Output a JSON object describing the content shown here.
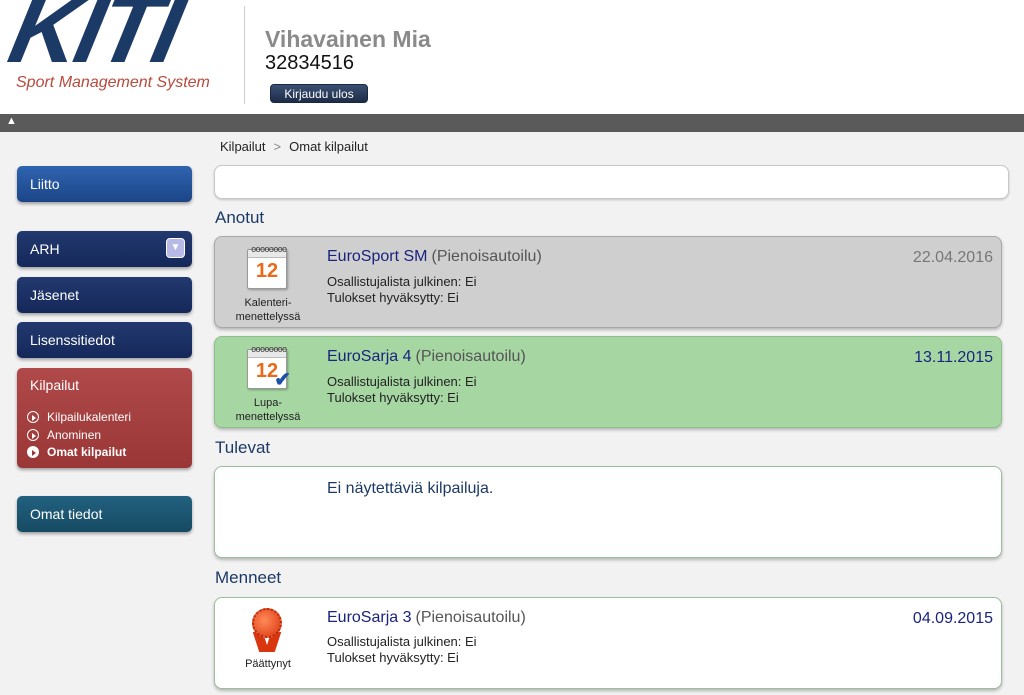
{
  "header": {
    "logo_text": "KITI",
    "logo_subtitle": "Sport Management System",
    "user_name": "Vihavainen Mia",
    "user_id": "32834516",
    "logout_label": "Kirjaudu ulos",
    "toggle_glyph": "▲"
  },
  "breadcrumb": {
    "items": [
      "Kilpailut",
      "Omat kilpailut"
    ],
    "separator": ">"
  },
  "sidebar": {
    "liitto": "Liitto",
    "arh": "ARH",
    "arh_toggle_glyph": "▼",
    "jasenet": "Jäsenet",
    "lisenssitiedot": "Lisenssitiedot",
    "kilpailut": {
      "title": "Kilpailut",
      "items": [
        "Kilpailukalenteri",
        "Anominen",
        "Omat kilpailut"
      ],
      "active_item": "Omat kilpailut"
    },
    "omat_tiedot": "Omat tiedot"
  },
  "sections": {
    "anotut": "Anotut",
    "tulevat": "Tulevat",
    "menneet": "Menneet"
  },
  "cards": {
    "card1": {
      "title": "EuroSport SM",
      "category": "(Pienoisautoilu)",
      "date": "22.04.2016",
      "line1": "Osallistujalista julkinen: Ei",
      "line2": "Tulokset hyväksytty: Ei",
      "icon_label": "Kalenteri-\nmenettelyssä",
      "icon_num": "12"
    },
    "card2": {
      "title": "EuroSarja 4",
      "category": "(Pienoisautoilu)",
      "date": "13.11.2015",
      "line1": "Osallistujalista julkinen: Ei",
      "line2": "Tulokset hyväksytty: Ei",
      "icon_label": "Lupa-\nmenettelyssä",
      "icon_num": "12"
    },
    "empty": {
      "text": "Ei näytettäviä kilpailuja."
    },
    "card3": {
      "title": "EuroSarja 3",
      "category": "(Pienoisautoilu)",
      "date": "04.09.2015",
      "line1": "Osallistujalista julkinen: Ei",
      "line2": "Tulokset hyväksytty: Ei",
      "icon_label": "Päättynyt"
    }
  },
  "colors": {
    "header_bar": "#5a5a5a",
    "nav_blue": "#1c4587",
    "nav_red": "#9a3636",
    "card_grey": "#cfcfcf",
    "card_green": "#a6d7a3",
    "title_blue": "#1a237e"
  },
  "icons": {
    "card1": "calendar-icon",
    "card2": "calendar-check-icon",
    "card3": "award-ribbon-icon"
  }
}
